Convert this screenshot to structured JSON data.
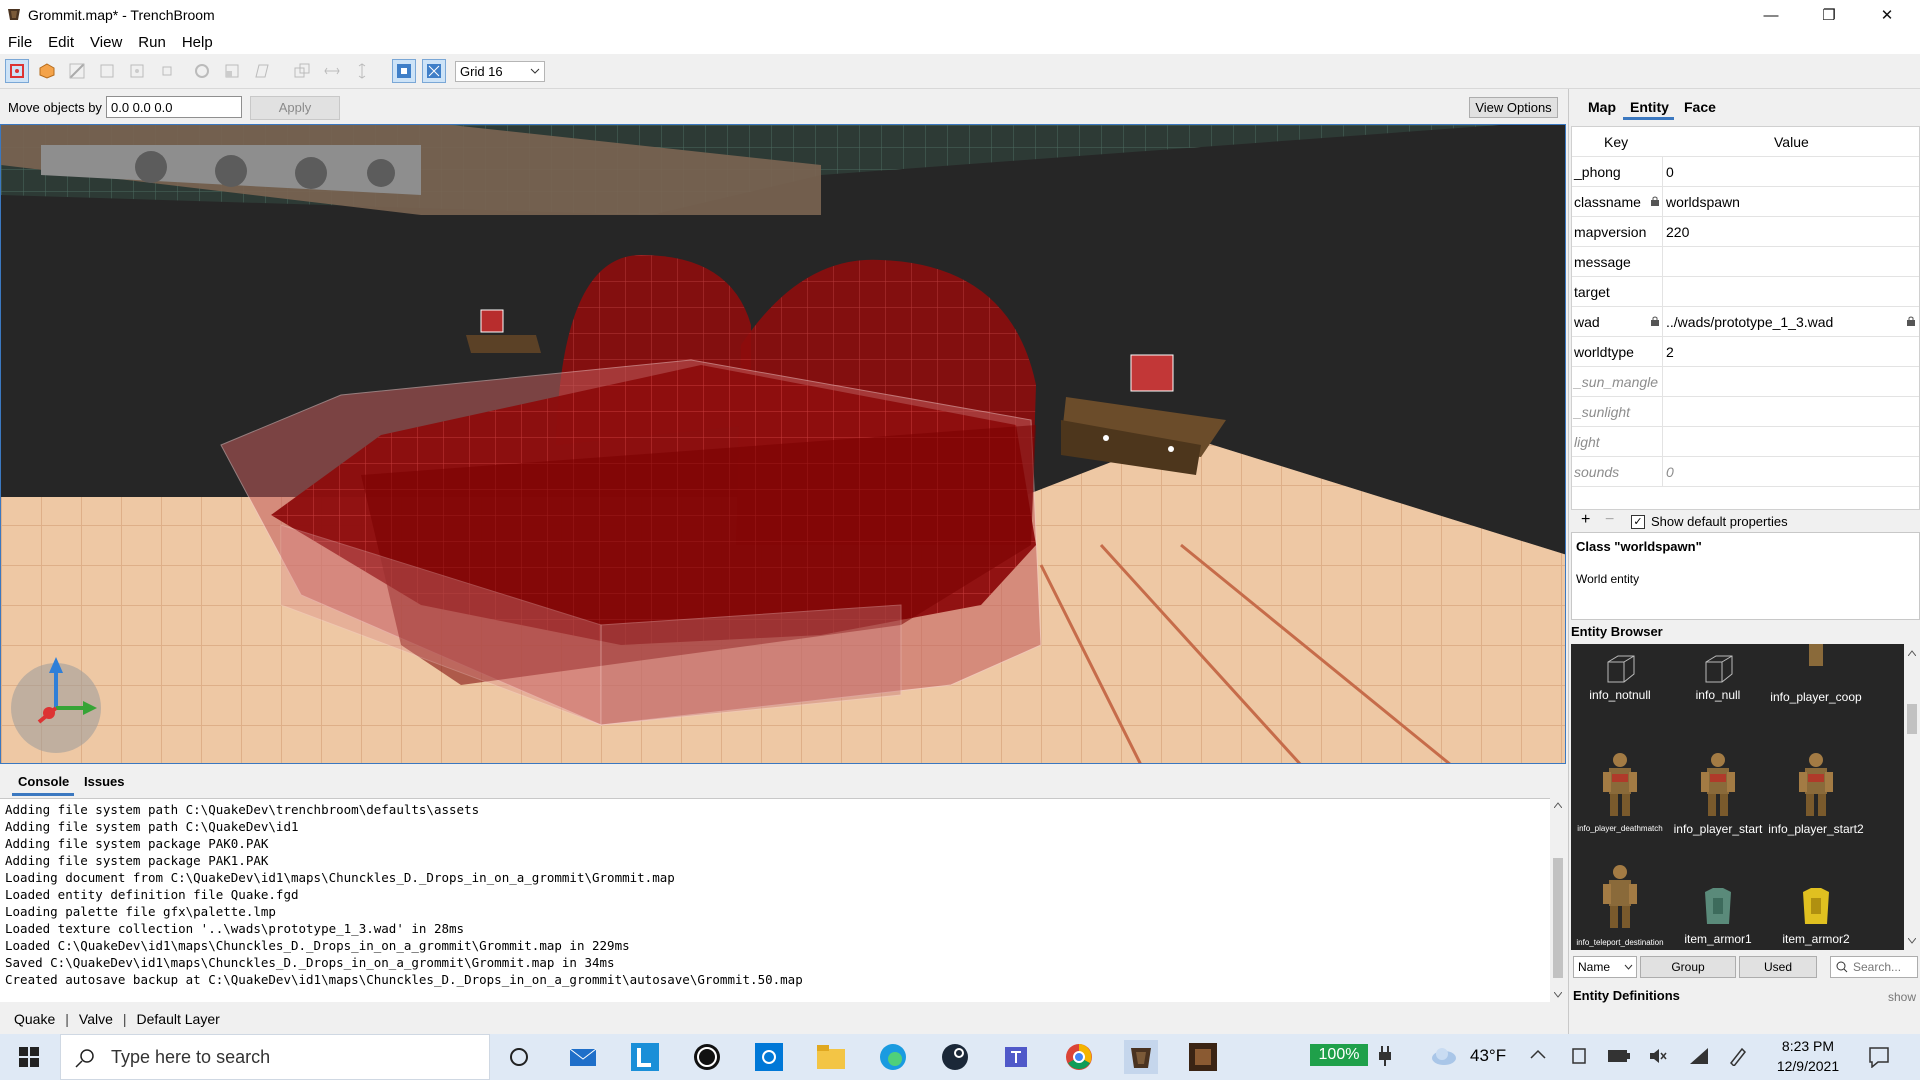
{
  "window": {
    "title": "Grommit.map* - TrenchBroom",
    "controls": [
      "—",
      "❐",
      "✕"
    ]
  },
  "menu": [
    "File",
    "Edit",
    "View",
    "Run",
    "Help"
  ],
  "toolbar": {
    "grid_label": "Grid 16"
  },
  "movebar": {
    "label": "Move objects by",
    "value": "0.0 0.0 0.0",
    "apply": "Apply",
    "view_options": "View Options"
  },
  "console": {
    "tabs": [
      "Console",
      "Issues"
    ],
    "lines": [
      "Adding file system path C:\\QuakeDev\\trenchbroom\\defaults\\assets",
      "Adding file system path C:\\QuakeDev\\id1",
      "Adding file system package PAK0.PAK",
      "Adding file system package PAK1.PAK",
      "Loading document from C:\\QuakeDev\\id1\\maps\\Chunckles_D._Drops_in_on_a_grommit\\Grommit.map",
      "Loaded entity definition file Quake.fgd",
      "Loading palette file gfx\\palette.lmp",
      "Loaded texture collection '..\\wads\\prototype_1_3.wad' in 28ms",
      "Loaded C:\\QuakeDev\\id1\\maps\\Chunckles_D._Drops_in_on_a_grommit\\Grommit.map in 229ms",
      "Saved C:\\QuakeDev\\id1\\maps\\Chunckles_D._Drops_in_on_a_grommit\\Grommit.map in 34ms",
      "Created autosave backup at C:\\QuakeDev\\id1\\maps\\Chunckles_D._Drops_in_on_a_grommit\\autosave\\Grommit.50.map"
    ]
  },
  "statusbar": {
    "game": "Quake",
    "format": "Valve",
    "layer": "Default Layer"
  },
  "inspector": {
    "tabs": [
      "Map",
      "Entity",
      "Face"
    ],
    "key_header": "Key",
    "value_header": "Value",
    "properties": [
      {
        "key": "_phong",
        "value": "0"
      },
      {
        "key": "classname",
        "value": "worldspawn"
      },
      {
        "key": "mapversion",
        "value": "220"
      },
      {
        "key": "message",
        "value": ""
      },
      {
        "key": "target",
        "value": ""
      },
      {
        "key": "wad",
        "value": "../wads/prototype_1_3.wad"
      },
      {
        "key": "worldtype",
        "value": "2"
      },
      {
        "key": "_sun_mangle",
        "value": ""
      },
      {
        "key": "_sunlight",
        "value": ""
      },
      {
        "key": "light",
        "value": ""
      },
      {
        "key": "sounds",
        "value": "0"
      }
    ],
    "add": "+",
    "remove": "−",
    "show_defaults": "Show default properties",
    "class_title": "Class \"worldspawn\"",
    "class_desc": "World entity"
  },
  "entity_browser": {
    "title": "Entity Browser",
    "entities": [
      {
        "name": "info_notnull"
      },
      {
        "name": "info_null"
      },
      {
        "name": "info_player_coop"
      },
      {
        "name": "info_player_deathmatch"
      },
      {
        "name": "info_player_start"
      },
      {
        "name": "info_player_start2"
      },
      {
        "name": "info_teleport_destination"
      },
      {
        "name": "item_armor1"
      },
      {
        "name": "item_armor2"
      }
    ],
    "sort": "Name",
    "group": "Group",
    "used": "Used",
    "search_placeholder": "Search...",
    "defs_label": "Entity Definitions",
    "defs_show": "show"
  },
  "taskbar": {
    "search_placeholder": "Type here to search",
    "battery": "100%",
    "temperature": "43°F",
    "time": "8:23 PM",
    "date": "12/9/2021"
  }
}
